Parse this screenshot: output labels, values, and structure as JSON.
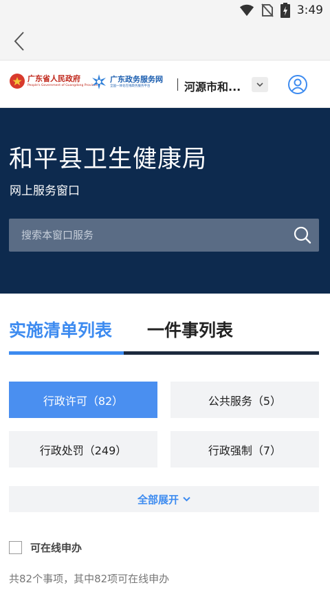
{
  "status_bar": {
    "time": "3:49"
  },
  "portal": {
    "gov_name": "广东省人民政府",
    "gov_name_en": "People's Government of Guangdong Province",
    "service_name": "广东政务服务网",
    "service_sub": "全国一体化在线政务服务平台",
    "region": "河源市和..."
  },
  "hero": {
    "title": "和平县卫生健康局",
    "subtitle": "网上服务窗口",
    "search_placeholder": "搜索本窗口服务"
  },
  "tabs": [
    {
      "label": "实施清单列表",
      "active": true
    },
    {
      "label": "一件事列表",
      "active": false
    }
  ],
  "categories": [
    {
      "label": "行政许可（82）",
      "active": true
    },
    {
      "label": "公共服务（5）",
      "active": false
    },
    {
      "label": "行政处罚（249）",
      "active": false
    },
    {
      "label": "行政强制（7）",
      "active": false
    }
  ],
  "expand_label": "全部展开",
  "online_filter_label": "可在线申办",
  "summary": "共82个事项，其中82项可在线申办",
  "colors": {
    "accent": "#3d8bf0",
    "hero_bg": "#0d2a4e"
  }
}
